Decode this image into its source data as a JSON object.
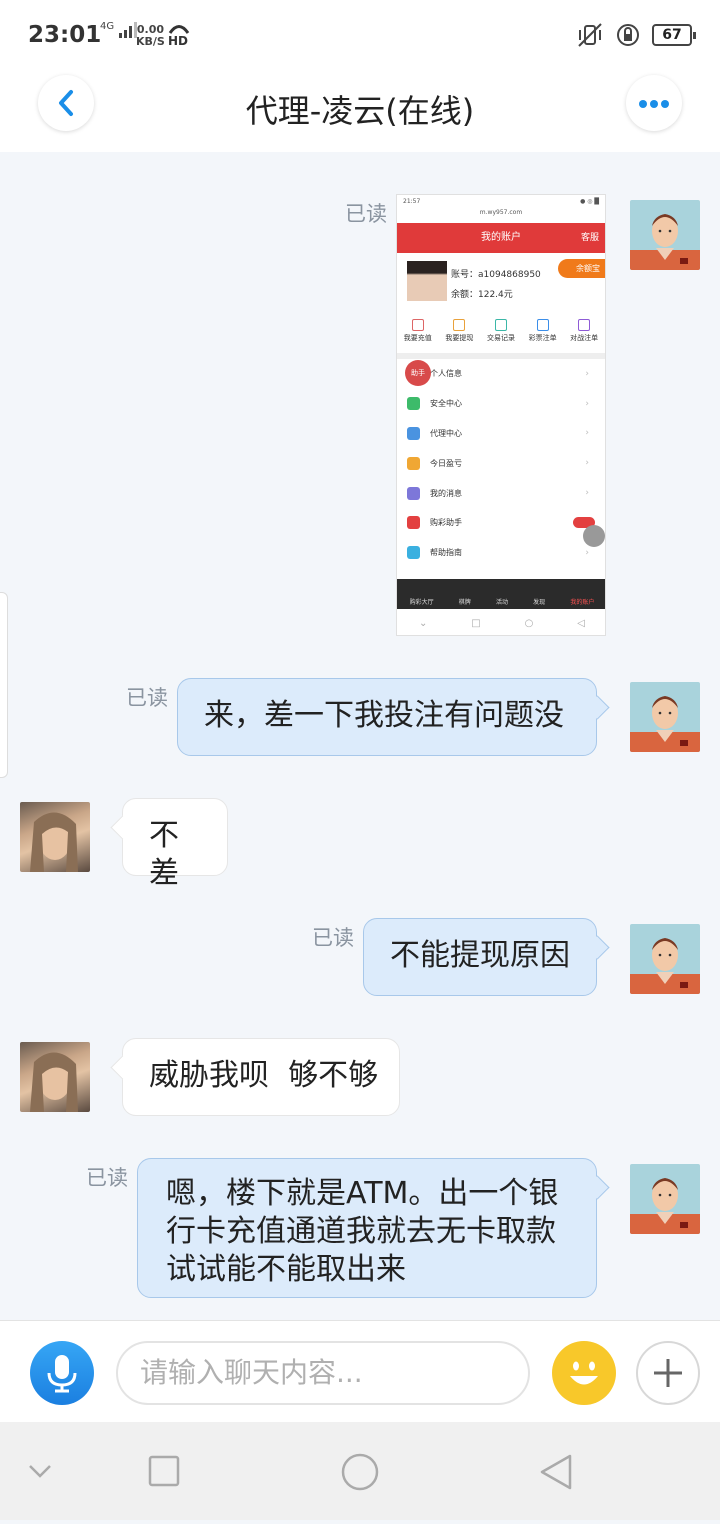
{
  "status_bar": {
    "time": "23:01",
    "network": "4G",
    "speed_value": "0.00",
    "speed_unit": "KB/S",
    "hd": "HD",
    "battery": "67"
  },
  "header": {
    "title": "代理-凌云(在线)",
    "back_icon": "chevron-left-icon",
    "more_icon": "more-horizontal-icon",
    "accent_color": "#1a8ee8"
  },
  "messages": [
    {
      "sender": "me",
      "type": "image",
      "read": "已读"
    },
    {
      "sender": "me",
      "type": "text",
      "read": "已读",
      "text": "来，差一下我投注有问题没"
    },
    {
      "sender": "her",
      "type": "text",
      "text": "不差"
    },
    {
      "sender": "me",
      "type": "text",
      "read": "已读",
      "text": "不能提现原因"
    },
    {
      "sender": "her",
      "type": "text",
      "text": "威胁我呗  够不够"
    },
    {
      "sender": "me",
      "type": "text",
      "read": "已读",
      "lines": [
        "嗯，楼下就是ATM。出一个银",
        "行卡充值通道我就去无卡取款",
        "试试能不能取出来"
      ]
    }
  ],
  "shared_screenshot": {
    "status_time": "21:57",
    "status_right": "● ◎ █",
    "url": "m.wy957.com",
    "page_title": "我的账户",
    "service": "客服",
    "account_label": "账号：a1094868950",
    "balance_label": "余额：122.4元",
    "badge": "余额宝",
    "quick_actions": [
      "我要充值",
      "我要提现",
      "交易记录",
      "彩票注单",
      "对战注单"
    ],
    "menu": [
      "个人信息",
      "安全中心",
      "代理中心",
      "今日盈亏",
      "我的消息",
      "购彩助手",
      "帮助指南"
    ],
    "helper_badge": "助手",
    "tabs": [
      "购彩大厅",
      "棋牌",
      "活动",
      "发现",
      "我的账户"
    ]
  },
  "input_bar": {
    "placeholder": "请输入聊天内容...",
    "mic_icon": "microphone-icon",
    "emoji_icon": "smiley-icon",
    "plus_icon": "plus-icon"
  }
}
